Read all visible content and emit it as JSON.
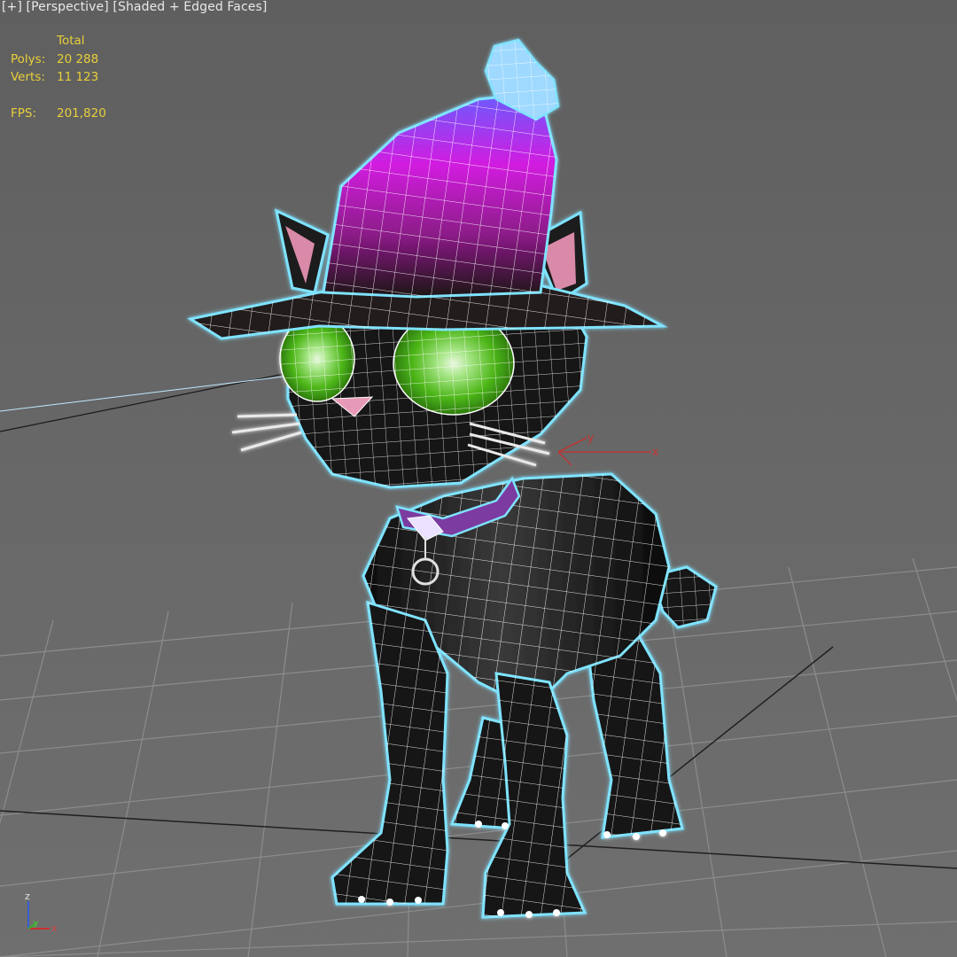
{
  "viewport": {
    "label_plus": "[+]",
    "label_view": "[Perspective]",
    "label_shading": "[Shaded + Edged Faces]"
  },
  "stats": {
    "header": "Total",
    "polys_label": "Polys:",
    "polys_value": "20 288",
    "verts_label": "Verts:",
    "verts_value": "11 123",
    "fps_label": "FPS:",
    "fps_value": "201,820"
  },
  "axes": {
    "x": "x",
    "y": "y",
    "z": "z"
  },
  "gizmo": {
    "x": "x",
    "y": "y"
  },
  "colors": {
    "selection": "#7fe3ff",
    "stats_text": "#e8cf3a",
    "hat": "#c21cc9",
    "eyes": "#6ac81f",
    "collar": "#7b3aa0",
    "body": "#141414"
  }
}
